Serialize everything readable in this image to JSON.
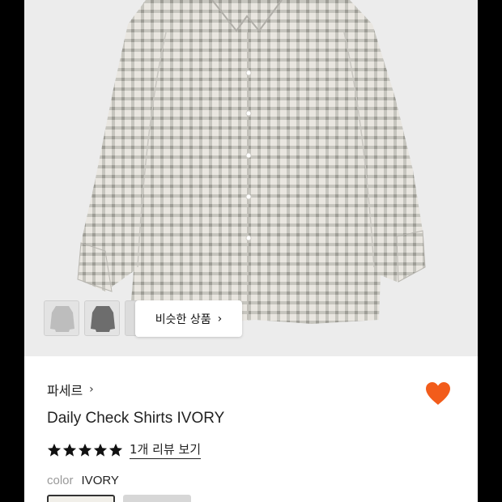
{
  "similar_products": {
    "label": "비슷한 상품",
    "chevron": "›"
  },
  "thumbnails": [
    {
      "name": "thumb-ivory",
      "color": "#cfcfcf"
    },
    {
      "name": "thumb-charcoal",
      "color": "#6d6d6d"
    }
  ],
  "product": {
    "brand": "파세르",
    "brand_chevron": "›",
    "title": "Daily Check Shirts IVORY",
    "rating": 5,
    "review_link": "1개 리뷰 보기",
    "color_label": "color",
    "color_value": "IVORY"
  },
  "colors": {
    "heart": "#f25c1b",
    "star": "#111111",
    "image_bg": "#ececec"
  }
}
